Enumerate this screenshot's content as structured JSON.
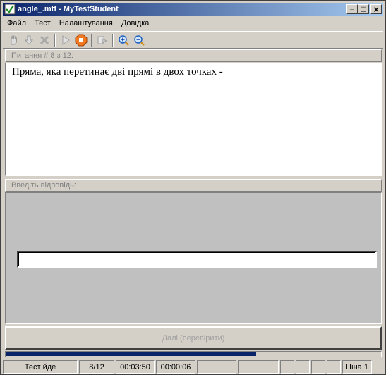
{
  "window": {
    "title": "angle_.mtf - MyTestStudent",
    "controls": {
      "minimize": "_",
      "maximize": "□",
      "close": "×"
    }
  },
  "menu": [
    "Файл",
    "Тест",
    "Налаштування",
    "Довідка"
  ],
  "toolbar": [
    {
      "icon": "hand-icon"
    },
    {
      "icon": "arrow-down-icon"
    },
    {
      "icon": "delete-x-icon"
    },
    {
      "icon": "play-icon"
    },
    {
      "icon": "stop-icon"
    },
    {
      "icon": "next-page-icon"
    },
    {
      "icon": "zoom-in-icon"
    },
    {
      "icon": "zoom-out-icon"
    }
  ],
  "question": {
    "header": "Питання # 8 з 12:",
    "text": "Пряма, яка перетинає дві прямі в двох точках -"
  },
  "answer": {
    "header": "Введіть відповідь:",
    "value": ""
  },
  "next_button": "Далі (перевірити)",
  "progress": {
    "value": 0.667,
    "color": "#0a246a"
  },
  "status": {
    "state": "Тест йде",
    "question_counter": "8/12",
    "time_elapsed": "00:03:50",
    "time_question": "00:00:06",
    "price": "Ціна 1"
  }
}
